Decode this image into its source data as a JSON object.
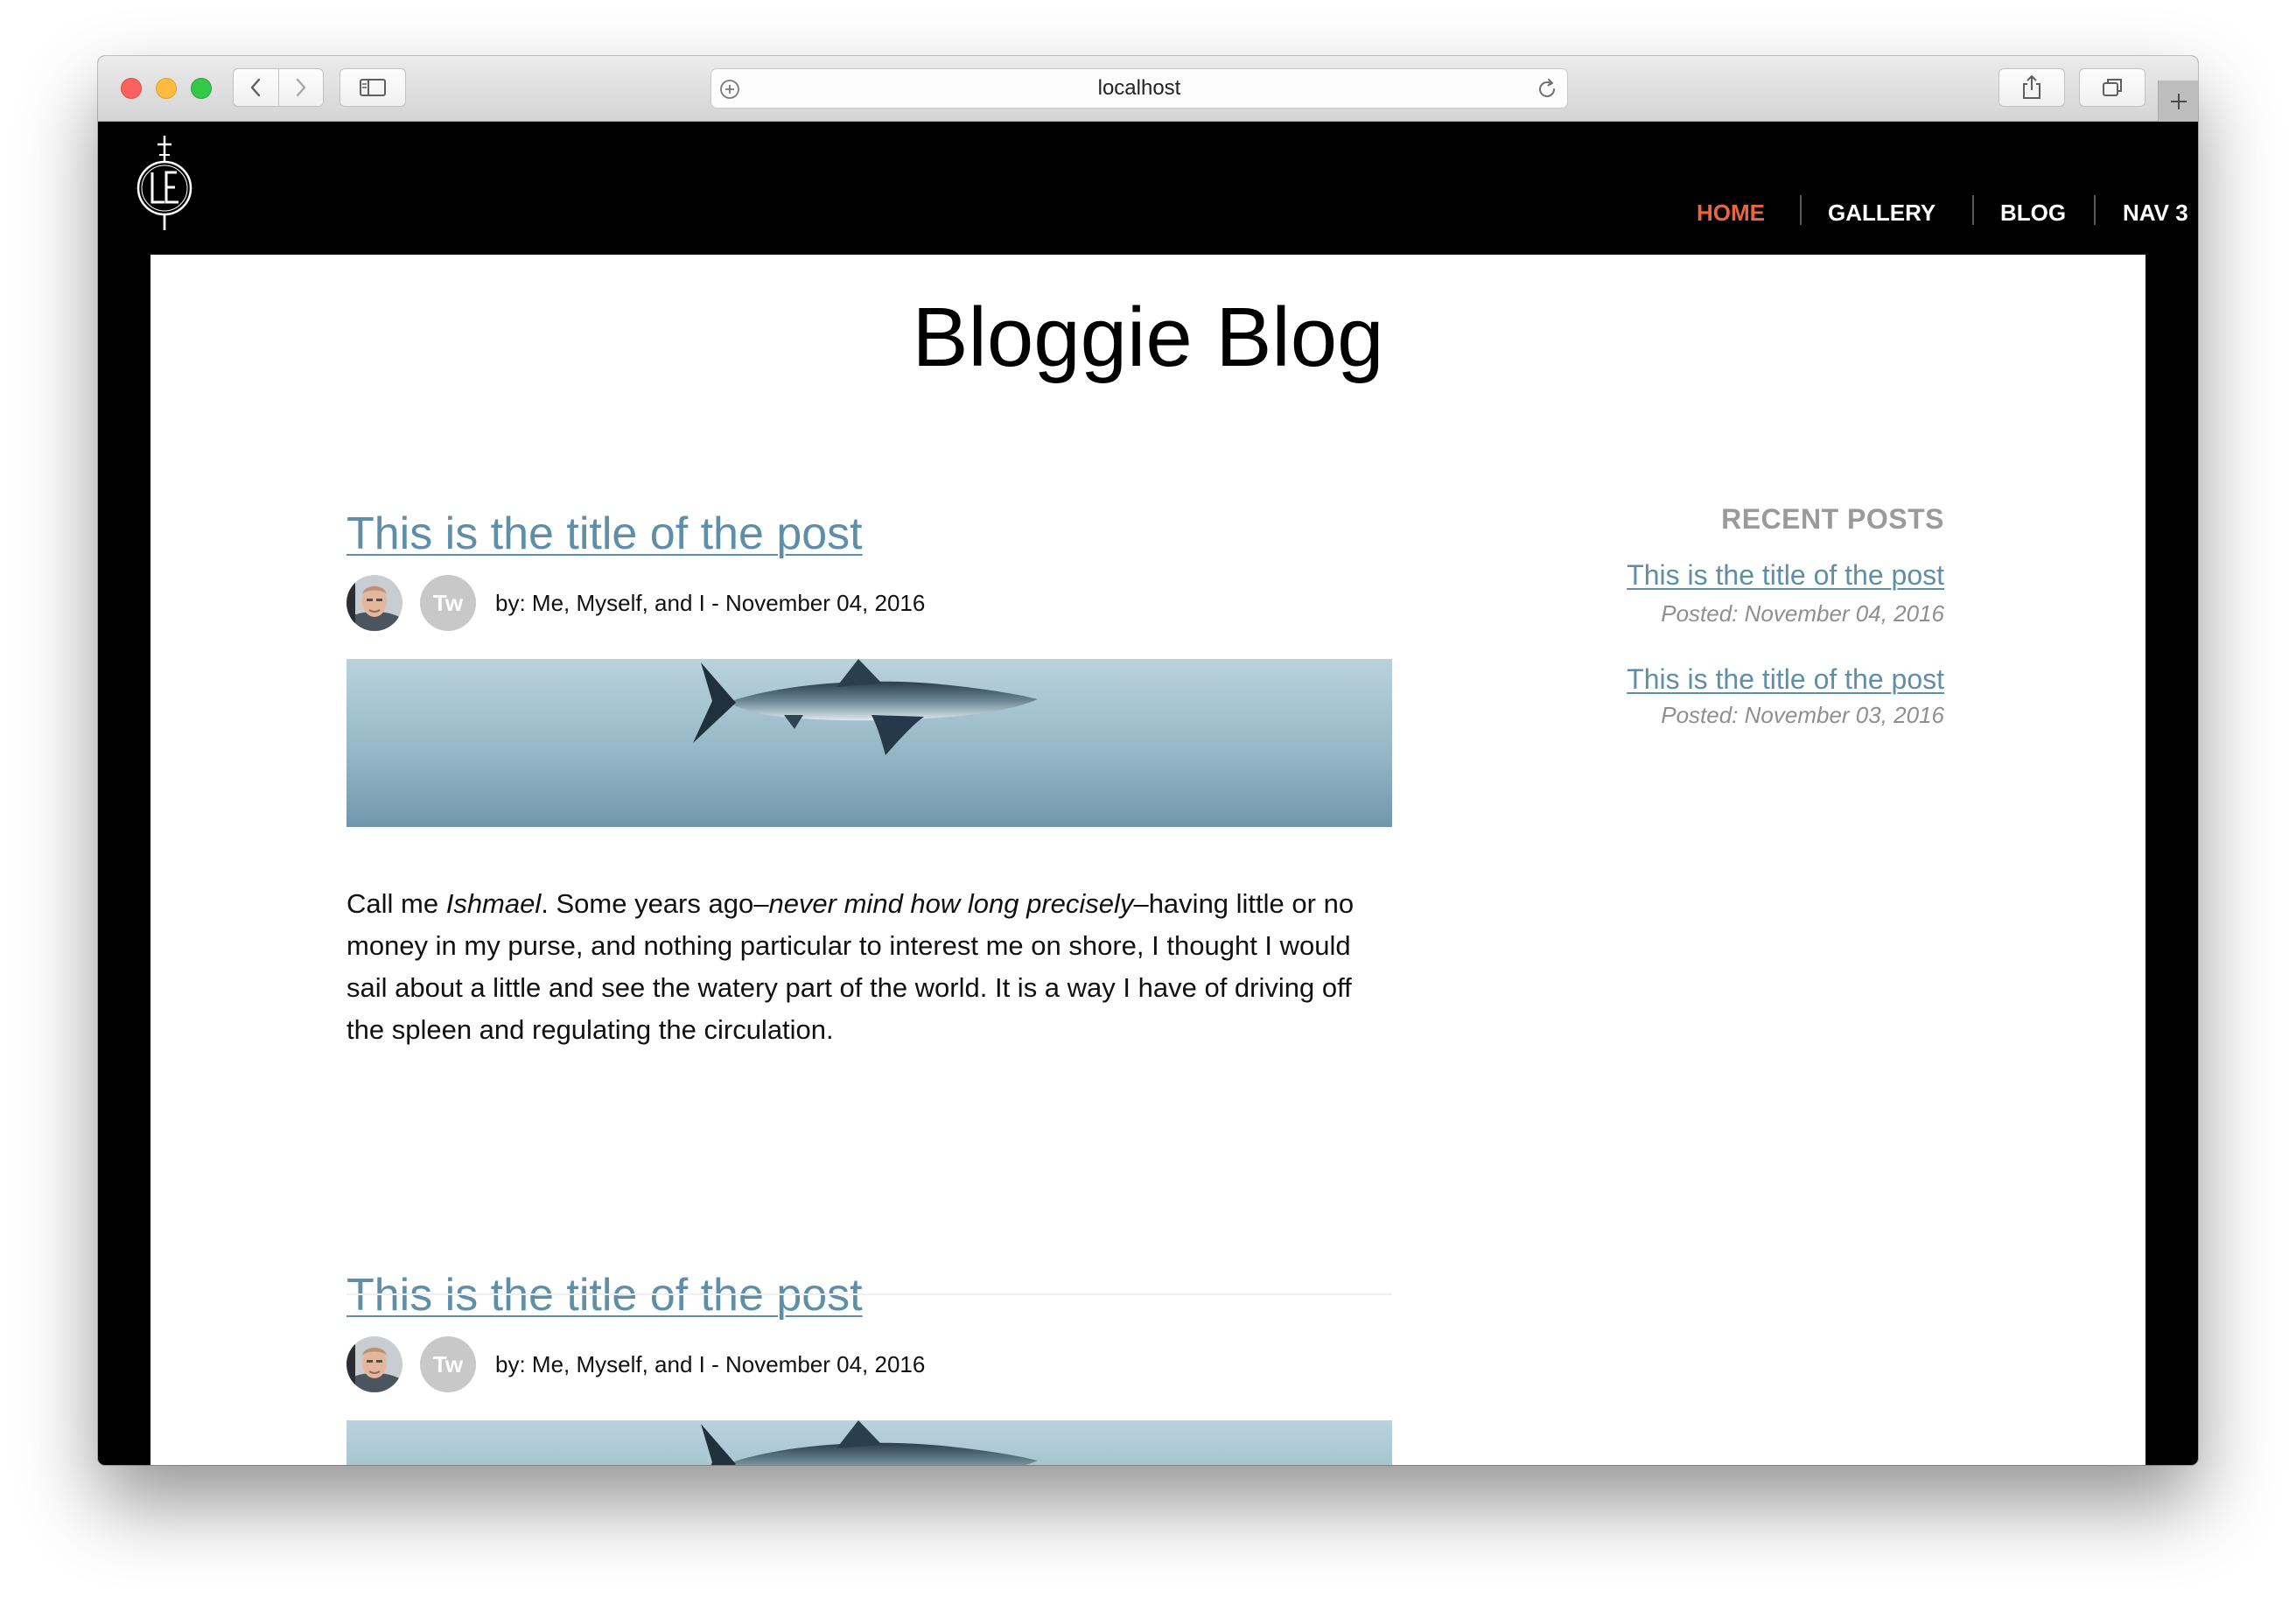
{
  "browser": {
    "url": "localhost"
  },
  "site": {
    "nav": [
      {
        "label": "HOME",
        "active": true
      },
      {
        "label": "GALLERY",
        "active": false
      },
      {
        "label": "BLOG",
        "active": false
      },
      {
        "label": "NAV 3",
        "active": false
      }
    ],
    "blog_title": "Bloggie Blog",
    "accent_color": "#e8673c",
    "link_color": "#5f8ea9"
  },
  "posts": [
    {
      "title": "This is the title of the post",
      "avatar_badge": "Tw",
      "byline": "by: Me, Myself, and I - November 04, 2016",
      "body": {
        "p1": "Call me ",
        "em1": "Ishmael",
        "p2": ". Some years ago–",
        "em2": "never mind how long precisely",
        "p3": "–having little or no money in my purse, and nothing particular to interest me on shore, I thought I would sail about a little and see the watery part of the world. It is a way I have of driving off the spleen and regulating the circulation."
      }
    },
    {
      "title": "This is the title of the post",
      "avatar_badge": "Tw",
      "byline": "by: Me, Myself, and I - November 04, 2016"
    }
  ],
  "sidebar": {
    "heading": "RECENT POSTS",
    "recent": [
      {
        "title": "This is the title of the post",
        "posted": "Posted: November 04, 2016"
      },
      {
        "title": "This is the title of the post",
        "posted": "Posted: November 03, 2016"
      }
    ]
  }
}
